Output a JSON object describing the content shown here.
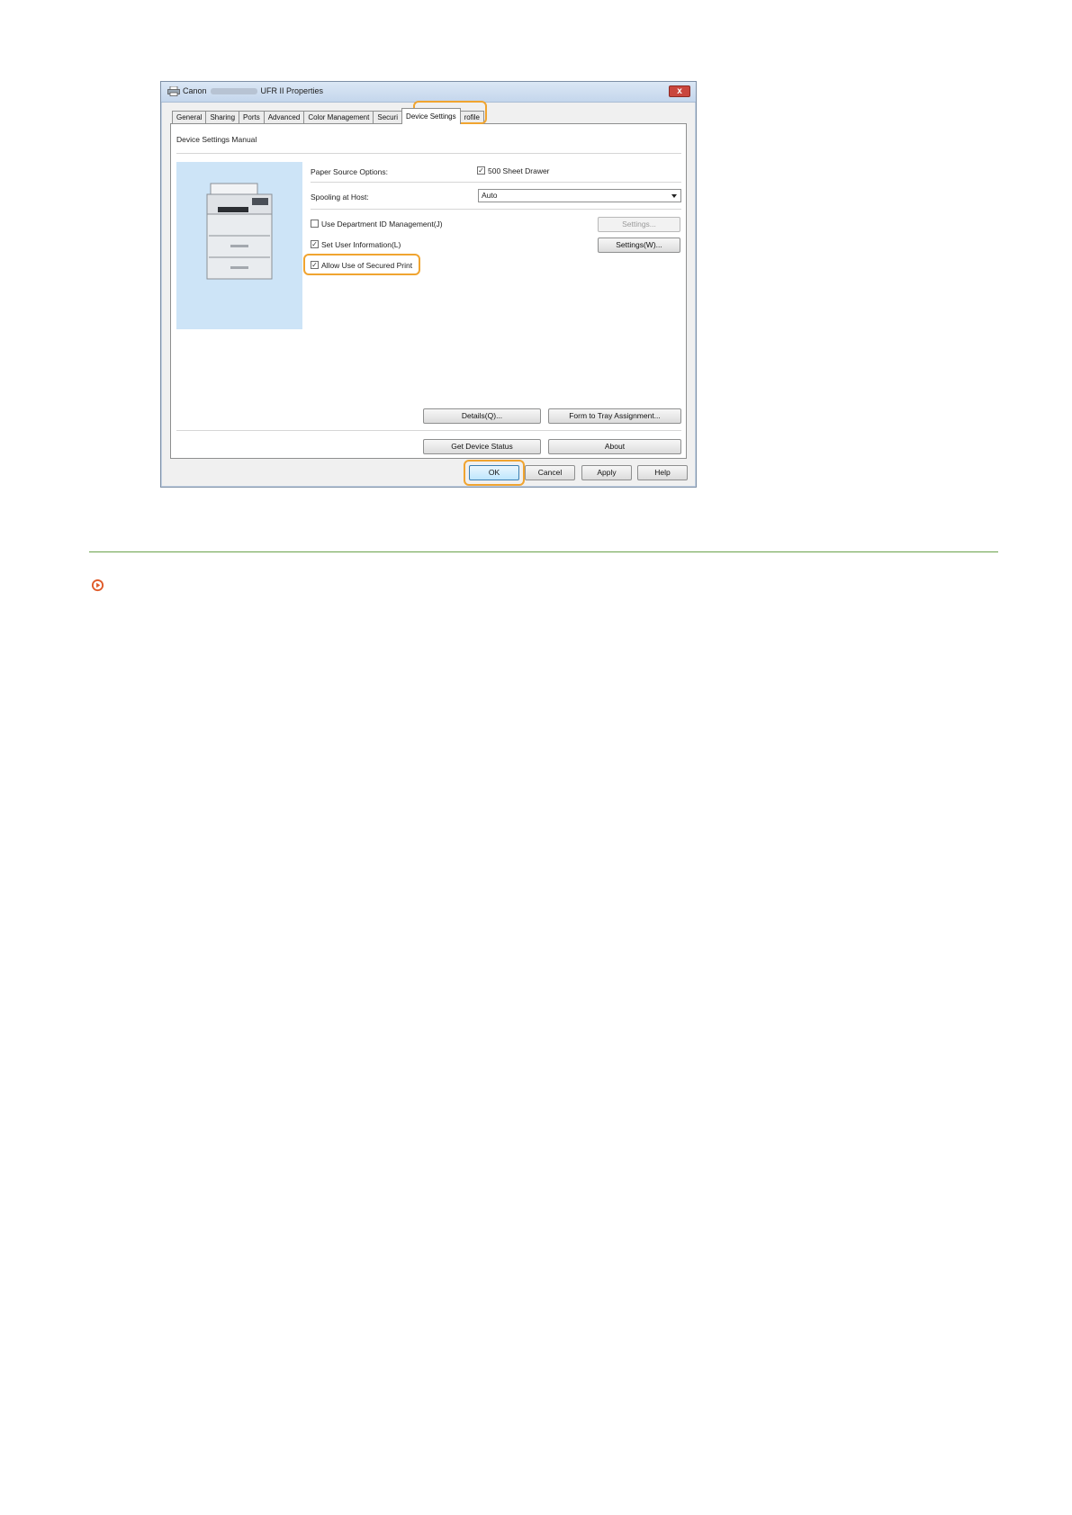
{
  "dialog": {
    "title_prefix": "Canon",
    "title_suffix": "UFR II Properties",
    "close_label": "x"
  },
  "tabs": [
    {
      "label": "General"
    },
    {
      "label": "Sharing"
    },
    {
      "label": "Ports"
    },
    {
      "label": "Advanced"
    },
    {
      "label": "Color Management"
    },
    {
      "label": "Securi"
    },
    {
      "label": "Device Settings"
    },
    {
      "label": "rofile"
    }
  ],
  "panel": {
    "section_title": "Device Settings Manual",
    "paper_source_label": "Paper Source Options:",
    "drawer_label": "500 Sheet Drawer",
    "drawer_checked": true,
    "spooling_label": "Spooling at Host:",
    "spooling_value": "Auto",
    "dept_id_label": "Use Department ID Management(J)",
    "dept_id_checked": false,
    "user_info_label": "Set User Information(L)",
    "user_info_checked": true,
    "secured_print_label": "Allow Use of Secured Print",
    "secured_print_checked": true,
    "settings_disabled_label": "Settings...",
    "settings_w_label": "Settings(W)...",
    "details_label": "Details(Q)...",
    "form_tray_label": "Form to Tray Assignment...",
    "device_status_label": "Get Device Status",
    "about_label": "About"
  },
  "footer": {
    "ok_label": "OK",
    "cancel_label": "Cancel",
    "apply_label": "Apply",
    "help_label": "Help"
  },
  "check_mark": "✓",
  "colors": {
    "highlight": "#f0a430",
    "rule": "#6aa24b",
    "link_icon": "#e05a28",
    "preview_bg": "#cde4f7"
  },
  "icons": {
    "app": "printer-icon",
    "close": "close-icon",
    "dropdown": "chevron-down-icon",
    "link": "arrow-circle-icon"
  }
}
